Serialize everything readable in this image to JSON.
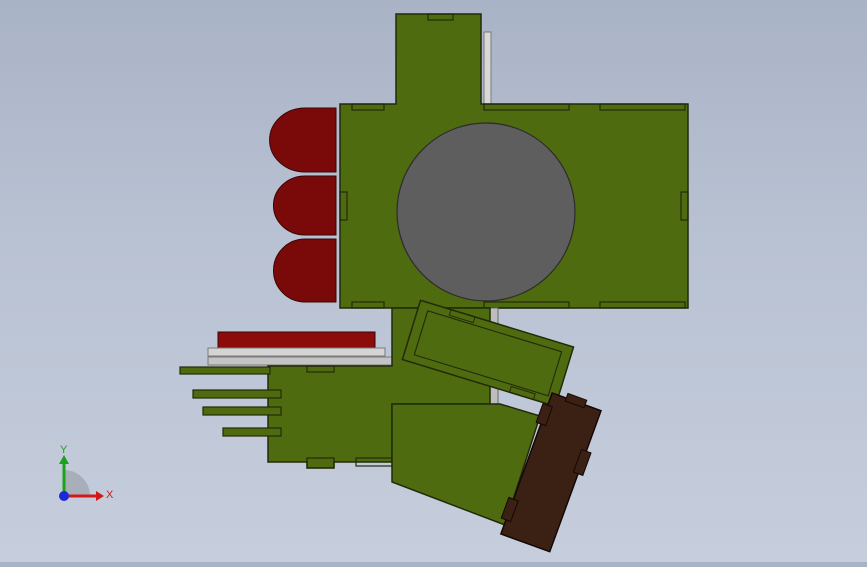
{
  "viewport": {
    "name": "cad-graphics-viewport",
    "colors": {
      "background_top": "#a9b3c6",
      "background_bottom": "#c6cedd",
      "body": "#4f6b10",
      "body_edge": "#222a08",
      "disc": "#5e5e5e",
      "red_part": "#7a0a0a",
      "brown_part": "#3b2014",
      "silver": "#d6d6d6"
    }
  },
  "triad": {
    "x_label": "X",
    "y_label": "Y",
    "x_color": "#d21919",
    "y_color": "#1aa31a",
    "z_color": "#1c2ad6"
  }
}
